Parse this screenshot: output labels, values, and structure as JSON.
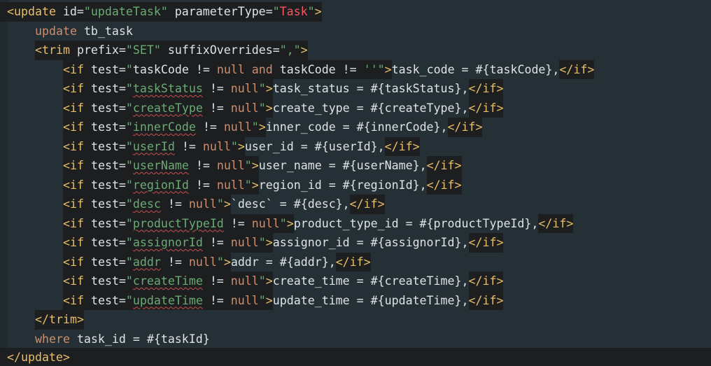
{
  "lines": [
    {
      "open": "<update ",
      "a1": "id=",
      "v1": "\"updateTask\"",
      "a2": " parameterType=",
      "q1": "\"",
      "type": "Task",
      "q2": "\"",
      "close": ">"
    },
    {
      "kw": "update",
      "rest": " tb_task"
    },
    {
      "open": "<trim ",
      "a1": "prefix=",
      "v1": "\"SET\"",
      "a2": " suffixOverrides=",
      "v2": "\",\"",
      "close": ">"
    },
    {
      "open": "<if ",
      "attr": "test=",
      "q": "\"",
      "f1": "taskCode",
      "op1": " != ",
      "k1": "null",
      "and": " and ",
      "f2": "taskCode",
      "op2": " != ",
      "k2": "''",
      "qe": "\"",
      "gt": ">",
      "body": "task_code = #{taskCode},",
      "end": "</if>"
    },
    {
      "open": "<if ",
      "attr": "test=",
      "q": "\"",
      "field": "taskStatus",
      "op": " != ",
      "k": "null",
      "qe": "\"",
      "gt": ">",
      "body": "task_status = #{taskStatus},",
      "end": "</if>"
    },
    {
      "open": "<if ",
      "attr": "test=",
      "q": "\"",
      "field": "createType",
      "op": " != ",
      "k": "null",
      "qe": "\"",
      "gt": ">",
      "body": "create_type = #{createType},",
      "end": "</if>"
    },
    {
      "open": "<if ",
      "attr": "test=",
      "q": "\"",
      "field": "innerCode",
      "op": " != ",
      "k": "null",
      "qe": "\"",
      "gt": ">",
      "body": "inner_code = #{innerCode},",
      "end": "</if>"
    },
    {
      "open": "<if ",
      "attr": "test=",
      "q": "\"",
      "field": "userId",
      "op": " != ",
      "k": "null",
      "qe": "\"",
      "gt": ">",
      "body": "user_id = #{userId},",
      "end": "</if>"
    },
    {
      "open": "<if ",
      "attr": "test=",
      "q": "\"",
      "field": "userName",
      "op": " != ",
      "k": "null",
      "qe": "\"",
      "gt": ">",
      "body": "user_name = #{userName},",
      "end": "</if>"
    },
    {
      "open": "<if ",
      "attr": "test=",
      "q": "\"",
      "field": "regionId",
      "op": " != ",
      "k": "null",
      "qe": "\"",
      "gt": ">",
      "body": "region_id = #{regionId},",
      "end": "</if>"
    },
    {
      "open": "<if ",
      "attr": "test=",
      "q": "\"",
      "field": "desc",
      "op": " != ",
      "k": "null",
      "qe": "\"",
      "gt": ">",
      "body": "`desc` = #{desc},",
      "end": "</if>"
    },
    {
      "open": "<if ",
      "attr": "test=",
      "q": "\"",
      "field": "productTypeId",
      "op": " != ",
      "k": "null",
      "qe": "\"",
      "gt": ">",
      "body": "product_type_id = #{productTypeId},",
      "end": "</if>"
    },
    {
      "open": "<if ",
      "attr": "test=",
      "q": "\"",
      "field": "assignorId",
      "op": " != ",
      "k": "null",
      "qe": "\"",
      "gt": ">",
      "body": "assignor_id = #{assignorId},",
      "end": "</if>"
    },
    {
      "open": "<if ",
      "attr": "test=",
      "q": "\"",
      "field": "addr",
      "op": " != ",
      "k": "null",
      "qe": "\"",
      "gt": ">",
      "body": "addr = #{addr},",
      "end": "</if>"
    },
    {
      "open": "<if ",
      "attr": "test=",
      "q": "\"",
      "field": "createTime",
      "op": " != ",
      "k": "null",
      "qe": "\"",
      "gt": ">",
      "body": "create_time = #{createTime},",
      "end": "</if>"
    },
    {
      "open": "<if ",
      "attr": "test=",
      "q": "\"",
      "field": "updateTime",
      "op": " != ",
      "k": "null",
      "qe": "\"",
      "gt": ">",
      "body": "update_time = #{updateTime},",
      "end": "</if>"
    },
    {
      "tag": "</trim>"
    },
    {
      "kw": "where",
      "rest": " task_id = #{taskId}"
    },
    {
      "tag": "</update>"
    }
  ]
}
